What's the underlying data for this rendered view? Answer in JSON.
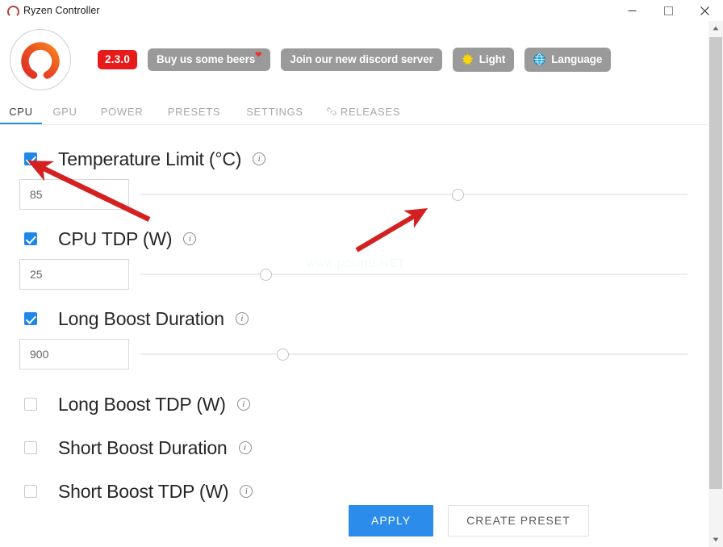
{
  "window": {
    "title": "Ryzen Controller",
    "icon": "ryzen-logo-icon",
    "minimize": "minimize-icon",
    "maximize": "maximize-icon",
    "close": "close-icon"
  },
  "header": {
    "logo": "ryzen-controller-logo",
    "version": "2.3.0",
    "buttons": [
      {
        "label": "Buy us some beers",
        "icon": "heart-icon",
        "name": "donate-button"
      },
      {
        "label": "Join our new discord server",
        "icon": null,
        "name": "discord-button"
      },
      {
        "label": "Light",
        "icon": "sun-icon",
        "name": "theme-toggle-button"
      },
      {
        "label": "Language",
        "icon": "globe-icon",
        "name": "language-button"
      }
    ]
  },
  "tabs": [
    {
      "label": "CPU",
      "active": true,
      "icon": null
    },
    {
      "label": "GPU",
      "active": false,
      "icon": null
    },
    {
      "label": "POWER",
      "active": false,
      "icon": null
    },
    {
      "label": "PRESETS",
      "active": false,
      "icon": null
    },
    {
      "label": "SETTINGS",
      "active": false,
      "icon": null
    },
    {
      "label": "RELEASES",
      "active": false,
      "icon": "link-icon"
    }
  ],
  "settings": [
    {
      "label": "Temperature Limit (°C)",
      "checked": true,
      "value": "85",
      "slider_percent": 58,
      "has_controls": true,
      "info": "info-icon"
    },
    {
      "label": "CPU TDP (W)",
      "checked": true,
      "value": "25",
      "slider_percent": 23,
      "has_controls": true,
      "info": "info-icon"
    },
    {
      "label": "Long Boost Duration",
      "checked": true,
      "value": "900",
      "slider_percent": 26,
      "has_controls": true,
      "info": "info-icon"
    },
    {
      "label": "Long Boost TDP (W)",
      "checked": false,
      "value": "",
      "slider_percent": 0,
      "has_controls": false,
      "info": "info-icon"
    },
    {
      "label": "Short Boost Duration",
      "checked": false,
      "value": "",
      "slider_percent": 0,
      "has_controls": false,
      "info": "info-icon"
    },
    {
      "label": "Short Boost TDP (W)",
      "checked": false,
      "value": "",
      "slider_percent": 0,
      "has_controls": false,
      "info": "info-icon"
    }
  ],
  "actions": {
    "apply": "APPLY",
    "create_preset": "CREATE PRESET"
  },
  "watermark": "www.pcsuru.NET",
  "colors": {
    "accent_blue": "#2b8ceb",
    "tab_underline": "#2b8fe0",
    "checkbox_on": "#1f87e8",
    "version_badge": "#e81b1b",
    "pill_gray": "#9a9a9a",
    "annotation_red": "#d42020",
    "logo_red": "#e03127",
    "logo_orange": "#f4701f"
  },
  "annotations": [
    {
      "name": "arrow-to-checkbox",
      "target": "temperature-limit-checkbox"
    },
    {
      "name": "arrow-to-slider",
      "target": "temperature-limit-slider-thumb"
    }
  ]
}
